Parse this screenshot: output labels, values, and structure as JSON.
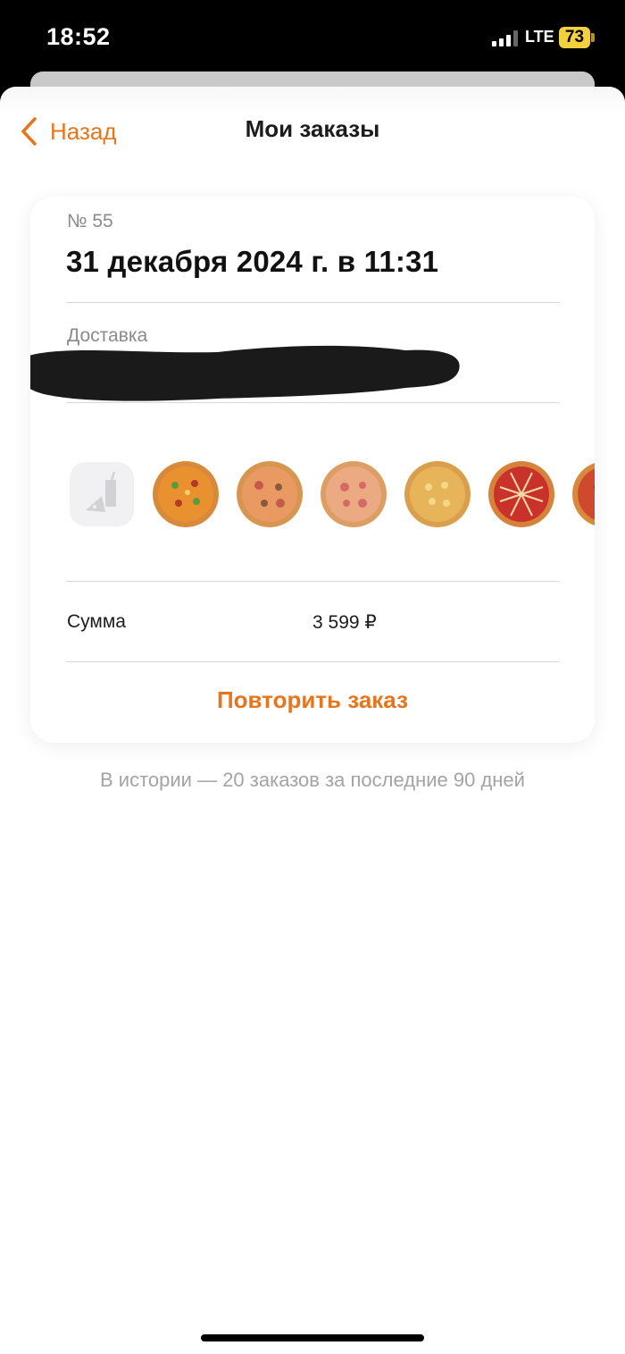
{
  "status_bar": {
    "time": "18:52",
    "network": "LTE",
    "battery": "73"
  },
  "nav": {
    "back_label": "Назад",
    "title": "Мои заказы"
  },
  "order": {
    "number": "№ 55",
    "date": "31 декабря 2024 г. в 11:31",
    "delivery_label": "Доставка",
    "items": [
      {
        "icon": "combo-icon"
      },
      {
        "icon": "pizza-icon",
        "color": "#e9902f"
      },
      {
        "icon": "pizza-icon",
        "color": "#e89a62"
      },
      {
        "icon": "pizza-icon",
        "color": "#ecaa83"
      },
      {
        "icon": "pizza-icon",
        "color": "#e8b45a"
      },
      {
        "icon": "pizza-icon",
        "color": "#c9322a"
      },
      {
        "icon": "pizza-icon",
        "color": "#cf4a2c"
      }
    ],
    "sum_label": "Сумма",
    "sum_value": "3 599 ₽",
    "repeat_label": "Повторить заказ"
  },
  "history_note": "В истории — 20 заказов за последние 90 дней",
  "colors": {
    "accent": "#e8751c",
    "muted_text": "#8a8a8e",
    "battery": "#f4d03f"
  }
}
